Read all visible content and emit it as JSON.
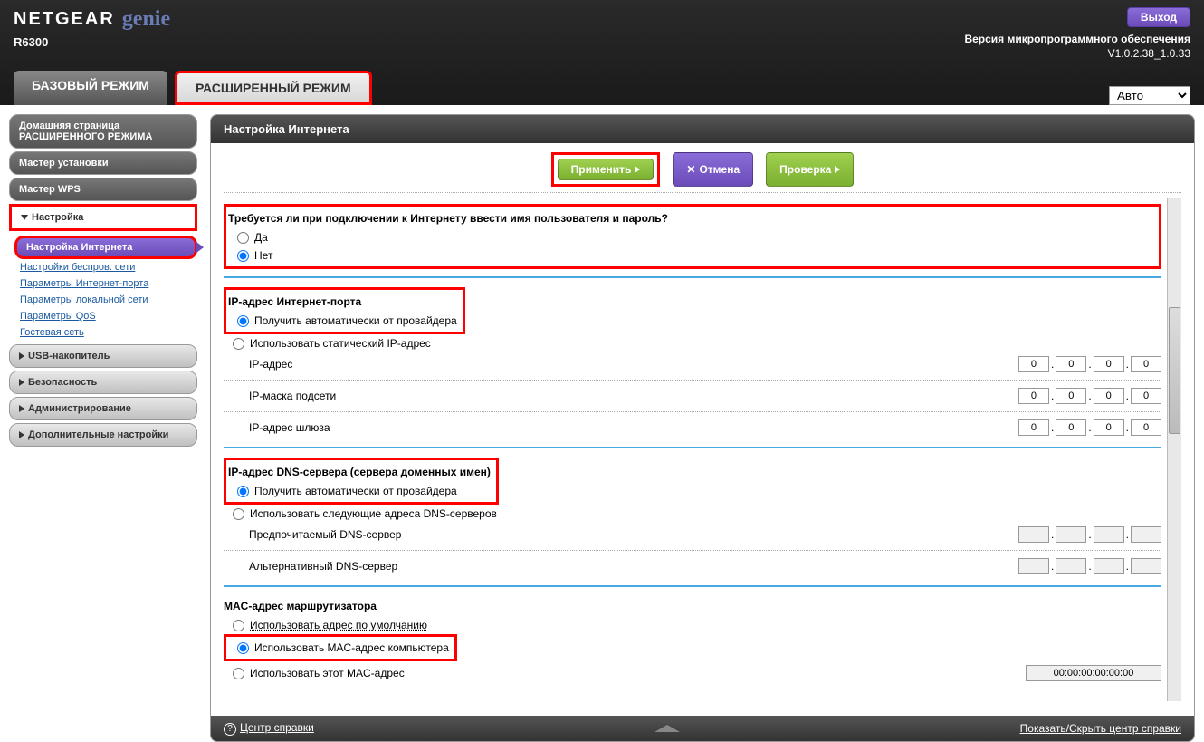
{
  "header": {
    "brand": "NETGEAR",
    "product": "genie",
    "model": "R6300",
    "logout": "Выход",
    "firmware_label": "Версия микропрограммного обеспечения",
    "firmware_version": "V1.0.2.38_1.0.33",
    "lang": "Авто"
  },
  "tabs": {
    "basic": "БАЗОВЫЙ РЕЖИМ",
    "advanced": "РАСШИРЕННЫЙ РЕЖИМ"
  },
  "sidebar": {
    "home1": "Домашняя страница",
    "home2": "РАСШИРЕННОГО РЕЖИМА",
    "setup_wizard": "Мастер установки",
    "wps_wizard": "Мастер WPS",
    "setup": "Настройка",
    "sub": {
      "internet": "Настройка Интернета",
      "wireless": "Настройки беспров. сети",
      "wan": "Параметры Интернет-порта",
      "lan": "Параметры локальной сети",
      "qos": "Параметры QoS",
      "guest": "Гостевая сеть"
    },
    "usb": "USB-накопитель",
    "security": "Безопасность",
    "admin": "Администрирование",
    "advanced": "Дополнительные настройки"
  },
  "main": {
    "title": "Настройка Интернета",
    "apply": "Применить",
    "cancel": "Отмена",
    "test": "Проверка",
    "login_q": "Требуется ли при подключении к Интернету ввести имя пользователя и пароль?",
    "yes": "Да",
    "no": "Нет",
    "ip_section": "IP-адрес Интернет-порта",
    "ip_auto": "Получить автоматически от провайдера",
    "ip_static": "Использовать статический IP-адрес",
    "ip_addr": "IP-адрес",
    "ip_mask": "IP-маска подсети",
    "ip_gw": "IP-адрес шлюза",
    "dns_section": "IP-адрес DNS-сервера (сервера доменных имен)",
    "dns_auto": "Получить автоматически от провайдера",
    "dns_use": "Использовать следующие адреса DNS-серверов",
    "dns_pref": "Предпочитаемый DNS-сервер",
    "dns_alt": "Альтернативный DNS-сервер",
    "mac_section": "MAC-адрес маршрутизатора",
    "mac_default": "Использовать адрес по умолчанию",
    "mac_pc": "Использовать MAC-адрес компьютера",
    "mac_this": "Использовать этот MAC-адрес",
    "mac_value": "00:00:00:00:00:00",
    "zero": "0",
    "empty": ""
  },
  "footer": {
    "help": "Центр справки",
    "toggle": "Показать/Скрыть центр справки"
  }
}
